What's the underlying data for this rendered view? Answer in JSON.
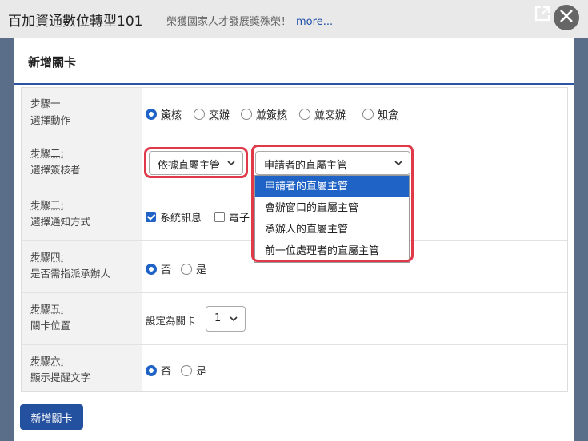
{
  "app": {
    "title": "百加資通數位轉型101",
    "marquee": "榮獲國家人才發展獎殊榮！",
    "more_link": "more..."
  },
  "modal": {
    "title": "新增關卡",
    "submit_label": "新增關卡"
  },
  "steps": [
    {
      "name": "步驟一",
      "desc": "選擇動作"
    },
    {
      "name": "步驟二:",
      "desc": "選擇簽核者"
    },
    {
      "name": "步驟三:",
      "desc": "選擇通知方式"
    },
    {
      "name": "步驟四:",
      "desc": "是否需指派承辦人"
    },
    {
      "name": "步驟五:",
      "desc": "關卡位置"
    },
    {
      "name": "步驟六:",
      "desc": "顯示提醒文字"
    }
  ],
  "actions": {
    "options": [
      "簽核",
      "交辦",
      "並簽核",
      "並交辦",
      "知會"
    ],
    "selected": "簽核"
  },
  "approver": {
    "mode_value": "依據直屬主管",
    "target_value": "申請者的直屬主管",
    "dropdown_options": [
      "申請者的直屬主管",
      "會辦窗口的直屬主管",
      "承辦人的直屬主管",
      "前一位處理者的直屬主管"
    ],
    "dropdown_selected": "申請者的直屬主管"
  },
  "notify": {
    "options": [
      "系統訊息",
      "電子"
    ],
    "checked": [
      true,
      false
    ]
  },
  "assign": {
    "options": [
      "否",
      "是"
    ],
    "selected": "否"
  },
  "position": {
    "label": "設定為關卡",
    "value": "1"
  },
  "reminder": {
    "options": [
      "否",
      "是"
    ],
    "selected": "否"
  },
  "colors": {
    "accent": "#1f63c6",
    "highlight": "#e0394a",
    "header_rule": "#2a55a5",
    "button": "#2450a0"
  }
}
